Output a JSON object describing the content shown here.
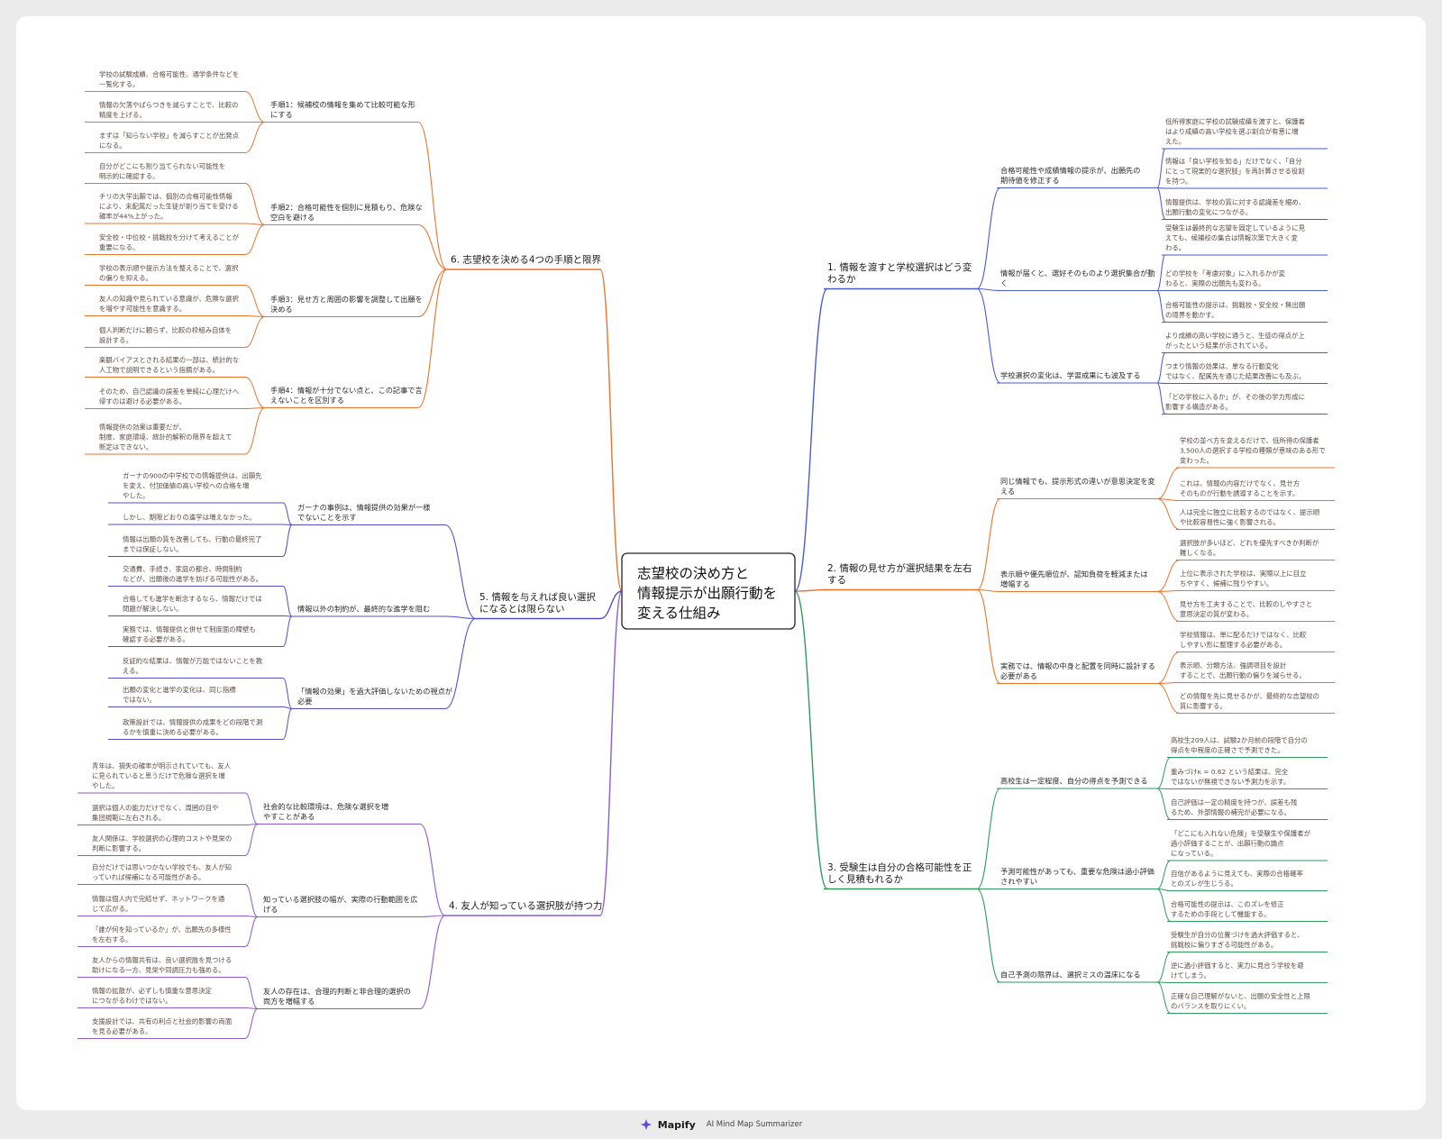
{
  "footer": {
    "brand": "Mapify",
    "tagline": "AI Mind Map Summarizer"
  },
  "colors": {
    "blue": "#4a5bd0",
    "orange": "#e8742e",
    "green": "#2e9a5e",
    "indigo": "#5550c8",
    "purple": "#8f5ad0"
  },
  "mindmap": {
    "root": {
      "lines": [
        "志望校の決め方と",
        "情報提示が出願行動を",
        "変える仕組み"
      ]
    },
    "branches": [
      {
        "color": "#4a5bd0",
        "lines": [
          "1. 情報を渡すと学校選択はどう変",
          "わるか"
        ],
        "children": [
          {
            "lines": [
              "合格可能性や成績情報の提示が、出願先の",
              "期待値を修正する"
            ],
            "leaves": [
              {
                "lines": [
                  "低所得家庭に学校の試験成績を渡すと、保護者",
                  "はより成績の高い学校を選ぶ割合が有意に増",
                  "えた。"
                ]
              },
              {
                "lines": [
                  "情報は「良い学校を知る」だけでなく、「自分",
                  "にとって現実的な選択肢」を再計算させる役割",
                  "を持つ。"
                ]
              },
              {
                "lines": [
                  "情報提供は、学校の質に対する認識差を縮め、",
                  "出願行動の変化につながる。"
                ]
              }
            ]
          },
          {
            "lines": [
              "情報が届くと、選好そのものより選択集合が動",
              "く"
            ],
            "leaves": [
              {
                "lines": [
                  "受験生は最終的な志望を固定しているように見",
                  "えても、候補校の集合は情報次第で大きく変",
                  "わる。"
                ]
              },
              {
                "lines": [
                  "どの学校を「考慮対象」に入れるかが変",
                  "わると、実際の出願先も変わる。"
                ]
              },
              {
                "lines": [
                  "合格可能性の提示は、挑戦校・安全校・無出願",
                  "の境界を動かす。"
                ]
              }
            ]
          },
          {
            "lines": [
              "学校選択の変化は、学習成果にも波及する"
            ],
            "leaves": [
              {
                "lines": [
                  "より成績の高い学校に通うと、生徒の得点が上",
                  "がったという結果が示されている。"
                ]
              },
              {
                "lines": [
                  "つまり情報の効果は、単なる行動変化",
                  "ではなく、配属先を通じた結果改善にも及ぶ。"
                ]
              },
              {
                "lines": [
                  "「どの学校に入るか」が、その後の学力形成に",
                  "影響する構造がある。"
                ]
              }
            ]
          }
        ]
      },
      {
        "color": "#e8742e",
        "lines": [
          "2. 情報の見せ方が選択結果を左右",
          "する"
        ],
        "children": [
          {
            "lines": [
              "同じ情報でも、提示形式の違いが意思決定を変",
              "える"
            ],
            "leaves": [
              {
                "lines": [
                  "学校の並べ方を変えるだけで、低所得の保護者",
                  "3,500人の選択する学校の種類が意味のある形で",
                  "変わった。"
                ]
              },
              {
                "lines": [
                  "これは、情報の内容だけでなく、見せ方",
                  "そのものが行動を誘導することを示す。"
                ]
              },
              {
                "lines": [
                  "人は完全に独立に比較するのではなく、提示順",
                  "や比較容易性に強く影響される。"
                ]
              }
            ]
          },
          {
            "lines": [
              "表示順や優先順位が、認知負荷を軽減または",
              "増幅する"
            ],
            "leaves": [
              {
                "lines": [
                  "選択肢が多いほど、どれを優先すべきか判断が",
                  "難しくなる。"
                ]
              },
              {
                "lines": [
                  "上位に表示された学校は、実際以上に目立",
                  "ちやすく、候補に残りやすい。"
                ]
              },
              {
                "lines": [
                  "見せ方を工夫することで、比較のしやすさと",
                  "意思決定の質が変わる。"
                ]
              }
            ]
          },
          {
            "lines": [
              "実務では、情報の中身と配置を同時に設計する",
              "必要がある"
            ],
            "leaves": [
              {
                "lines": [
                  "学校情報は、単に配るだけではなく、比較",
                  "しやすい形に整理する必要がある。"
                ]
              },
              {
                "lines": [
                  "表示順、分類方法、強調項目を設計",
                  "することで、出願行動の偏りを減らせる。"
                ]
              },
              {
                "lines": [
                  "どの情報を先に見せるかが、最終的な志望校の",
                  "質に影響する。"
                ]
              }
            ]
          }
        ]
      },
      {
        "color": "#2e9a5e",
        "lines": [
          "3. 受験生は自分の合格可能性を正",
          "しく見積もれるか"
        ],
        "children": [
          {
            "lines": [
              "高校生は一定程度、自分の得点を予測できる"
            ],
            "leaves": [
              {
                "lines": [
                  "高校生209人は、試験2か月前の段階で自分の",
                  "得点を中程度の正確さで予測できた。"
                ]
              },
              {
                "lines": [
                  "重みづけκ = 0.62 という結果は、完全",
                  "ではないが無視できない予測力を示す。"
                ]
              },
              {
                "lines": [
                  "自己評価は一定の精度を持つが、誤差も残",
                  "るため、外部情報の補完が必要になる。"
                ]
              }
            ]
          },
          {
            "lines": [
              "予測可能性があっても、重要な危険は過小評価",
              "されやすい"
            ],
            "leaves": [
              {
                "lines": [
                  "「どこにも入れない危険」を受験生や保護者が",
                  "過小評価することが、出願行動の論点",
                  "になっている。"
                ]
              },
              {
                "lines": [
                  "自信があるように見えても、実際の合格確率",
                  "とのズレが生じうる。"
                ]
              },
              {
                "lines": [
                  "合格可能性の提示は、このズレを修正",
                  "するための手段として機能する。"
                ]
              }
            ]
          },
          {
            "lines": [
              "自己予測の限界は、選択ミスの温床になる"
            ],
            "leaves": [
              {
                "lines": [
                  "受験生が自分の位置づけを過大評価すると、",
                  "挑戦校に偏りすぎる可能性がある。"
                ]
              },
              {
                "lines": [
                  "逆に過小評価すると、実力に見合う学校を避",
                  "けてしまう。"
                ]
              },
              {
                "lines": [
                  "正確な自己理解がないと、出願の安全性と上限",
                  "のバランスを取りにくい。"
                ]
              }
            ]
          }
        ]
      },
      {
        "color": "#8f5ad0",
        "lines": [
          "4. 友人が知っている選択肢が持つ力"
        ],
        "children": [
          {
            "lines": [
              "社会的な比較環境は、危険な選択を増",
              "やすことがある"
            ],
            "leaves": [
              {
                "lines": [
                  "青年は、損失の確率が明示されていても、友人",
                  "に見られていると思うだけで危険な選択を増",
                  "やした。"
                ]
              },
              {
                "lines": [
                  "選択は個人の能力だけでなく、周囲の目や",
                  "集団規範に左右される。"
                ]
              },
              {
                "lines": [
                  "友人関係は、学校選択の心理的コストや見栄の",
                  "判断に影響する。"
                ]
              }
            ]
          },
          {
            "lines": [
              "知っている選択肢の幅が、実際の行動範囲を広",
              "げる"
            ],
            "leaves": [
              {
                "lines": [
                  "自分だけでは思いつかない学校でも、友人が知",
                  "っていれば候補になる可能性がある。"
                ]
              },
              {
                "lines": [
                  "情報は個人内で完結せず、ネットワークを通",
                  "じて広がる。"
                ]
              },
              {
                "lines": [
                  "「誰が何を知っているか」が、出願先の多様性",
                  "を左右する。"
                ]
              }
            ]
          },
          {
            "lines": [
              "友人の存在は、合理的判断と非合理的選択の",
              "両方を増幅する"
            ],
            "leaves": [
              {
                "lines": [
                  "友人からの情報共有は、良い選択肢を見つける",
                  "助けになる一方、見栄や同調圧力も強める。"
                ]
              },
              {
                "lines": [
                  "情報の拡散が、必ずしも慎重な意思決定",
                  "につながるわけではない。"
                ]
              },
              {
                "lines": [
                  "支援設計では、共有の利点と社会的影響の両面",
                  "を見る必要がある。"
                ]
              }
            ]
          }
        ]
      },
      {
        "color": "#5550c8",
        "lines": [
          "5. 情報を与えれば良い選択",
          "になるとは限らない"
        ],
        "children": [
          {
            "lines": [
              "ガーナの事例は、情報提供の効果が一様",
              "でないことを示す"
            ],
            "leaves": [
              {
                "lines": [
                  "ガーナの900の中学校での情報提供は、出願先",
                  "を変え、付加価値の高い学校への合格を増",
                  "やした。"
                ]
              },
              {
                "lines": [
                  "しかし、期限どおりの進学は増えなかった。"
                ]
              },
              {
                "lines": [
                  "情報は出願の質を改善しても、行動の最終完了",
                  "までは保証しない。"
                ]
              }
            ]
          },
          {
            "lines": [
              "情報以外の制約が、最終的な進学を阻む"
            ],
            "leaves": [
              {
                "lines": [
                  "交通費、手続き、家庭の都合、時間制約",
                  "などが、出願後の進学を妨げる可能性がある。"
                ]
              },
              {
                "lines": [
                  "合格しても進学を断念するなら、情報だけでは",
                  "問題が解決しない。"
                ]
              },
              {
                "lines": [
                  "実務では、情報提供と併せて制度面の障壁も",
                  "確認する必要がある。"
                ]
              }
            ]
          },
          {
            "lines": [
              "「情報の効果」を過大評価しないための視点が",
              "必要"
            ],
            "leaves": [
              {
                "lines": [
                  "反証的な結果は、情報が万能ではないことを教",
                  "える。"
                ]
              },
              {
                "lines": [
                  "出願の変化と進学の変化は、同じ指標",
                  "ではない。"
                ]
              },
              {
                "lines": [
                  "政策設計では、情報提供の成果をどの段階で測",
                  "るかを慎重に決める必要がある。"
                ]
              }
            ]
          }
        ]
      },
      {
        "color": "#e8742e",
        "lines": [
          "6. 志望校を決める4つの手順と限界"
        ],
        "children": [
          {
            "lines": [
              "手順1：候補校の情報を集めて比較可能な形",
              "にする"
            ],
            "leaves": [
              {
                "lines": [
                  "学校の試験成績、合格可能性、通学条件などを",
                  "一覧化する。"
                ]
              },
              {
                "lines": [
                  "情報の欠落やばらつきを減らすことで、比較の",
                  "精度を上げる。"
                ]
              },
              {
                "lines": [
                  "まずは「知らない学校」を減らすことが出発点",
                  "になる。"
                ]
              }
            ]
          },
          {
            "lines": [
              "手順2：合格可能性を個別に見積もり、危険な",
              "空白を避ける"
            ],
            "leaves": [
              {
                "lines": [
                  "自分がどこにも割り当てられない可能性を",
                  "明示的に確認する。"
                ]
              },
              {
                "lines": [
                  "チリの大学出願では、個別の合格可能性情報",
                  "により、未配属だった生徒が割り当てを受ける",
                  "確率が44%上がった。"
                ]
              },
              {
                "lines": [
                  "安全校・中位校・挑戦校を分けて考えることが",
                  "重要になる。"
                ]
              }
            ]
          },
          {
            "lines": [
              "手順3：見せ方と周囲の影響を調整して出願を",
              "決める"
            ],
            "leaves": [
              {
                "lines": [
                  "学校の表示順や提示方法を整えることで、選択",
                  "の偏りを抑える。"
                ]
              },
              {
                "lines": [
                  "友人の知識や見られている意識が、危険な選択",
                  "を増やす可能性を意識する。"
                ]
              },
              {
                "lines": [
                  "個人判断だけに頼らず、比較の枠組み自体を",
                  "設計する。"
                ]
              }
            ]
          },
          {
            "lines": [
              "手順4：情報が十分でない点と、この記事で言",
              "えないことを区別する"
            ],
            "leaves": [
              {
                "lines": [
                  "楽観バイアスとされる結果の一部は、統計的な",
                  "人工物で説明できるという指摘がある。"
                ]
              },
              {
                "lines": [
                  "そのため、自己認識の誤差を単純に心理だけへ",
                  "帰すのは避ける必要がある。"
                ]
              },
              {
                "lines": [
                  "情報提供の効果は重要だが、",
                  "制度、家庭環境、統計的解釈の限界を超えて",
                  "断定はできない。"
                ]
              }
            ]
          }
        ]
      }
    ]
  }
}
